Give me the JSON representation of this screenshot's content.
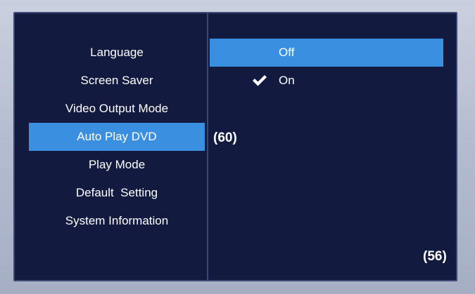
{
  "menu": {
    "items": [
      {
        "label": "Language",
        "selected": false
      },
      {
        "label": "Screen Saver",
        "selected": false
      },
      {
        "label": "Video Output Mode",
        "selected": false
      },
      {
        "label": "Auto Play DVD",
        "selected": true
      },
      {
        "label": "Play Mode",
        "selected": false
      },
      {
        "label": "Default  Setting",
        "selected": false
      },
      {
        "label": "System Information",
        "selected": false
      }
    ]
  },
  "options": {
    "items": [
      {
        "label": "Off",
        "highlighted": true,
        "checked": false
      },
      {
        "label": "On",
        "highlighted": false,
        "checked": true
      }
    ]
  },
  "markers": {
    "left": "(60)",
    "bottom_right": "(56)"
  },
  "icons": {
    "check": "checkmark-icon"
  },
  "colors": {
    "background": "#121a40",
    "highlight": "#3a8fe0",
    "text": "#ffffff"
  }
}
